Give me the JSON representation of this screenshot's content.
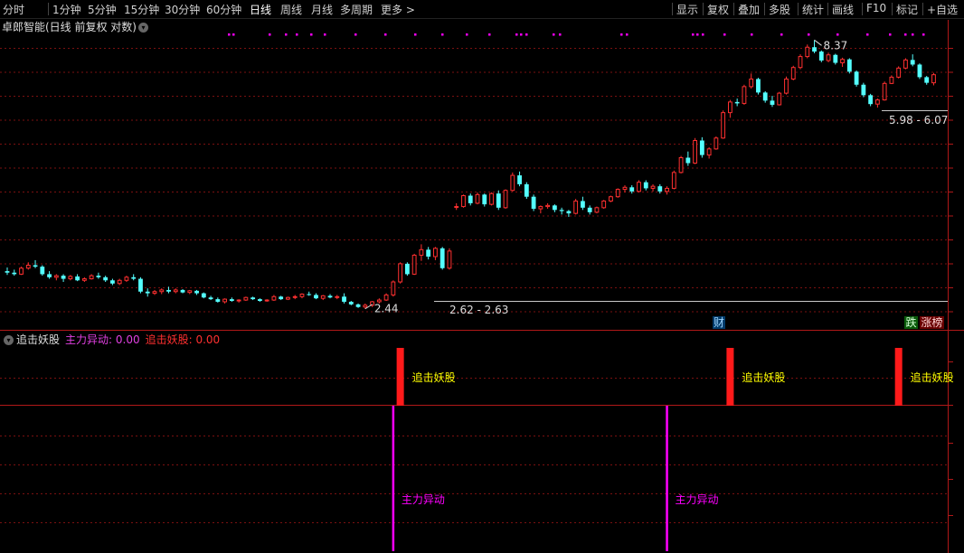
{
  "toolbar": {
    "left": [
      "分时",
      "1分钟",
      "5分钟",
      "15分钟",
      "30分钟",
      "60分钟",
      "日线",
      "周线",
      "月线",
      "多周期",
      "更多 >"
    ],
    "active_index": 6,
    "right": [
      "显示",
      "复权",
      "叠加",
      "多股",
      "统计",
      "画线",
      "F10",
      "标记",
      "+自选"
    ]
  },
  "chart": {
    "title": "卓郎智能(日线 前复权 对数)",
    "high_label": "8.37",
    "low_label": "2.44",
    "range_labels": [
      "2.62 - 2.63",
      "5.98 - 6.07"
    ],
    "badges": [
      "财",
      "跌",
      "涨榜"
    ]
  },
  "indicator": {
    "name": "追击妖股",
    "value_items": [
      {
        "label": "主力异动: 0.00",
        "color": "#e040e0"
      },
      {
        "label": "追击妖股: 0.00",
        "color": "#ff3030"
      }
    ],
    "signal_label_red": "追击妖股",
    "signal_label_magenta": "主力异动"
  },
  "colors": {
    "up": "#ff3030",
    "down": "#54ffff",
    "grid": "#7a1010",
    "magenta": "#ff00ff",
    "yellow": "#ffff00"
  },
  "chart_data": {
    "type": "candlestick",
    "price_scale": "log",
    "ohlc": [
      [
        2.9,
        2.95,
        2.85,
        2.88
      ],
      [
        2.88,
        2.92,
        2.84,
        2.86
      ],
      [
        2.86,
        2.96,
        2.85,
        2.94
      ],
      [
        2.94,
        3.02,
        2.92,
        2.98
      ],
      [
        2.98,
        3.05,
        2.94,
        2.96
      ],
      [
        2.96,
        2.98,
        2.84,
        2.86
      ],
      [
        2.86,
        2.9,
        2.8,
        2.82
      ],
      [
        2.82,
        2.86,
        2.78,
        2.84
      ],
      [
        2.84,
        2.86,
        2.76,
        2.8
      ],
      [
        2.8,
        2.85,
        2.78,
        2.83
      ],
      [
        2.83,
        2.86,
        2.77,
        2.78
      ],
      [
        2.78,
        2.82,
        2.76,
        2.8
      ],
      [
        2.8,
        2.86,
        2.79,
        2.84
      ],
      [
        2.84,
        2.88,
        2.8,
        2.82
      ],
      [
        2.82,
        2.84,
        2.76,
        2.78
      ],
      [
        2.78,
        2.8,
        2.72,
        2.74
      ],
      [
        2.74,
        2.8,
        2.72,
        2.78
      ],
      [
        2.78,
        2.84,
        2.76,
        2.82
      ],
      [
        2.82,
        2.86,
        2.78,
        2.8
      ],
      [
        2.8,
        2.82,
        2.62,
        2.64
      ],
      [
        2.64,
        2.68,
        2.58,
        2.62
      ],
      [
        2.62,
        2.66,
        2.6,
        2.64
      ],
      [
        2.64,
        2.68,
        2.61,
        2.66
      ],
      [
        2.66,
        2.7,
        2.62,
        2.64
      ],
      [
        2.64,
        2.68,
        2.62,
        2.66
      ],
      [
        2.66,
        2.67,
        2.62,
        2.63
      ],
      [
        2.63,
        2.66,
        2.61,
        2.65
      ],
      [
        2.65,
        2.66,
        2.6,
        2.62
      ],
      [
        2.62,
        2.63,
        2.56,
        2.57
      ],
      [
        2.57,
        2.59,
        2.54,
        2.55
      ],
      [
        2.55,
        2.57,
        2.51,
        2.52
      ],
      [
        2.52,
        2.56,
        2.5,
        2.55
      ],
      [
        2.55,
        2.57,
        2.52,
        2.53
      ],
      [
        2.53,
        2.55,
        2.51,
        2.54
      ],
      [
        2.54,
        2.58,
        2.53,
        2.57
      ],
      [
        2.57,
        2.58,
        2.54,
        2.55
      ],
      [
        2.55,
        2.56,
        2.52,
        2.53
      ],
      [
        2.53,
        2.55,
        2.52,
        2.54
      ],
      [
        2.54,
        2.6,
        2.53,
        2.58
      ],
      [
        2.58,
        2.59,
        2.54,
        2.55
      ],
      [
        2.55,
        2.58,
        2.54,
        2.57
      ],
      [
        2.57,
        2.6,
        2.55,
        2.58
      ],
      [
        2.58,
        2.62,
        2.56,
        2.61
      ],
      [
        2.61,
        2.64,
        2.59,
        2.6
      ],
      [
        2.6,
        2.62,
        2.55,
        2.56
      ],
      [
        2.56,
        2.6,
        2.54,
        2.59
      ],
      [
        2.59,
        2.61,
        2.56,
        2.57
      ],
      [
        2.57,
        2.6,
        2.55,
        2.58
      ],
      [
        2.58,
        2.62,
        2.5,
        2.52
      ],
      [
        2.52,
        2.53,
        2.48,
        2.49
      ],
      [
        2.49,
        2.5,
        2.45,
        2.46
      ],
      [
        2.46,
        2.5,
        2.44,
        2.48
      ],
      [
        2.48,
        2.53,
        2.46,
        2.52
      ],
      [
        2.52,
        2.56,
        2.5,
        2.54
      ],
      [
        2.54,
        2.62,
        2.53,
        2.6
      ],
      [
        2.6,
        2.78,
        2.58,
        2.76
      ],
      [
        2.76,
        3.02,
        2.74,
        3.0
      ],
      [
        3.0,
        3.02,
        2.84,
        2.86
      ],
      [
        2.86,
        3.14,
        2.85,
        3.12
      ],
      [
        3.12,
        3.28,
        3.04,
        3.2
      ],
      [
        3.2,
        3.24,
        3.06,
        3.1
      ],
      [
        3.1,
        3.24,
        3.05,
        3.22
      ],
      [
        3.22,
        3.24,
        2.92,
        2.94
      ],
      [
        2.94,
        3.22,
        2.92,
        3.18
      ],
      [
        3.9,
        3.96,
        3.84,
        3.9
      ],
      [
        3.9,
        4.12,
        3.88,
        4.1
      ],
      [
        4.1,
        4.14,
        3.92,
        3.96
      ],
      [
        3.96,
        4.16,
        3.94,
        4.12
      ],
      [
        4.12,
        4.14,
        3.9,
        3.94
      ],
      [
        3.94,
        4.16,
        3.92,
        4.14
      ],
      [
        4.14,
        4.2,
        3.84,
        3.88
      ],
      [
        3.88,
        4.22,
        3.86,
        4.2
      ],
      [
        4.2,
        4.56,
        4.18,
        4.5
      ],
      [
        4.5,
        4.58,
        4.28,
        4.32
      ],
      [
        4.32,
        4.36,
        4.04,
        4.08
      ],
      [
        4.08,
        4.12,
        3.82,
        3.86
      ],
      [
        3.86,
        3.92,
        3.78,
        3.9
      ],
      [
        3.9,
        3.96,
        3.86,
        3.92
      ],
      [
        3.92,
        3.94,
        3.8,
        3.84
      ],
      [
        3.84,
        3.88,
        3.76,
        3.82
      ],
      [
        3.82,
        3.84,
        3.72,
        3.78
      ],
      [
        3.78,
        4.04,
        3.76,
        4.0
      ],
      [
        4.0,
        4.08,
        3.84,
        3.88
      ],
      [
        3.88,
        3.92,
        3.76,
        3.8
      ],
      [
        3.8,
        3.9,
        3.78,
        3.88
      ],
      [
        3.88,
        4.02,
        3.86,
        4.0
      ],
      [
        4.0,
        4.1,
        3.98,
        4.08
      ],
      [
        4.08,
        4.24,
        4.06,
        4.22
      ],
      [
        4.22,
        4.3,
        4.16,
        4.26
      ],
      [
        4.26,
        4.3,
        4.14,
        4.18
      ],
      [
        4.18,
        4.4,
        4.16,
        4.36
      ],
      [
        4.36,
        4.4,
        4.2,
        4.24
      ],
      [
        4.24,
        4.32,
        4.18,
        4.28
      ],
      [
        4.28,
        4.32,
        4.14,
        4.18
      ],
      [
        4.18,
        4.28,
        4.12,
        4.24
      ],
      [
        4.24,
        4.6,
        4.22,
        4.56
      ],
      [
        4.56,
        4.92,
        4.54,
        4.88
      ],
      [
        4.88,
        5.02,
        4.7,
        4.76
      ],
      [
        4.76,
        5.34,
        4.74,
        5.28
      ],
      [
        5.28,
        5.36,
        4.88,
        4.94
      ],
      [
        4.94,
        5.12,
        4.86,
        5.08
      ],
      [
        5.08,
        5.38,
        5.06,
        5.34
      ],
      [
        5.34,
        6.06,
        5.32,
        6.0
      ],
      [
        6.0,
        6.36,
        5.86,
        6.3
      ],
      [
        6.3,
        6.4,
        6.18,
        6.26
      ],
      [
        6.26,
        6.82,
        6.22,
        6.76
      ],
      [
        6.76,
        7.18,
        6.7,
        7.0
      ],
      [
        7.0,
        7.04,
        6.52,
        6.58
      ],
      [
        6.58,
        6.62,
        6.28,
        6.34
      ],
      [
        6.34,
        6.48,
        6.16,
        6.22
      ],
      [
        6.22,
        6.6,
        6.2,
        6.56
      ],
      [
        6.56,
        7.08,
        6.52,
        7.0
      ],
      [
        7.0,
        7.44,
        6.96,
        7.38
      ],
      [
        7.38,
        7.84,
        7.32,
        7.76
      ],
      [
        7.76,
        8.2,
        7.7,
        8.1
      ],
      [
        8.1,
        8.37,
        7.88,
        7.94
      ],
      [
        7.94,
        7.98,
        7.56,
        7.62
      ],
      [
        7.62,
        7.9,
        7.56,
        7.82
      ],
      [
        7.82,
        7.86,
        7.48,
        7.54
      ],
      [
        7.54,
        7.72,
        7.4,
        7.66
      ],
      [
        7.66,
        7.7,
        7.18,
        7.24
      ],
      [
        7.24,
        7.28,
        6.76,
        6.82
      ],
      [
        6.82,
        6.88,
        6.44,
        6.5
      ],
      [
        6.5,
        6.54,
        6.18,
        6.24
      ],
      [
        6.24,
        6.4,
        6.14,
        6.36
      ],
      [
        6.36,
        6.92,
        6.34,
        6.86
      ],
      [
        6.86,
        7.12,
        6.84,
        7.06
      ],
      [
        7.06,
        7.42,
        7.02,
        7.36
      ],
      [
        7.36,
        7.7,
        7.32,
        7.64
      ],
      [
        7.64,
        7.84,
        7.42,
        7.48
      ],
      [
        7.48,
        7.52,
        7.0,
        7.06
      ],
      [
        7.06,
        7.1,
        6.82,
        6.88
      ],
      [
        6.88,
        7.2,
        6.8,
        7.14
      ]
    ],
    "signals": {
      "追击妖股": [
        56,
        103,
        127
      ],
      "主力异动": [
        55,
        94
      ]
    },
    "indicator_values": {
      "主力异动": 0.0,
      "追击妖股": 0.0
    }
  }
}
